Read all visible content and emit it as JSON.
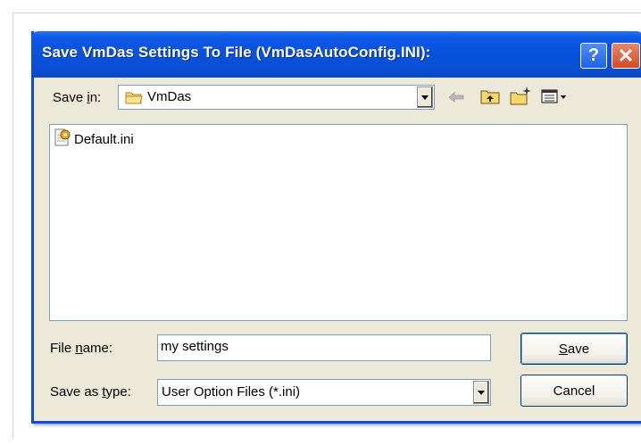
{
  "window": {
    "title": "Save VmDas Settings To File (VmDasAutoConfig.INI):",
    "help_label": "?",
    "close_label": "✕"
  },
  "toolbar": {
    "save_in_label_pre": "Save ",
    "save_in_label_ul": "i",
    "save_in_label_post": "n:",
    "save_in_value": "VmDas",
    "icons": [
      "back-arrow-icon",
      "up-folder-icon",
      "new-folder-icon",
      "view-menu-icon"
    ]
  },
  "files": [
    {
      "name": "Default.ini",
      "icon": "ini-file-icon"
    }
  ],
  "form": {
    "file_name_label_pre": "File ",
    "file_name_label_ul": "n",
    "file_name_label_post": "ame:",
    "file_name_value": "my settings",
    "save_type_label_pre": "Save as ",
    "save_type_label_ul": "t",
    "save_type_label_post": "ype:",
    "save_type_value": "User Option Files (*.ini)"
  },
  "buttons": {
    "save_ul": "S",
    "save_rest": "ave",
    "cancel": "Cancel"
  },
  "colors": {
    "titlebar": "#0652d9",
    "dialog_bg": "#ece9d8",
    "border": "#0a4be0",
    "close": "#d14a22"
  }
}
